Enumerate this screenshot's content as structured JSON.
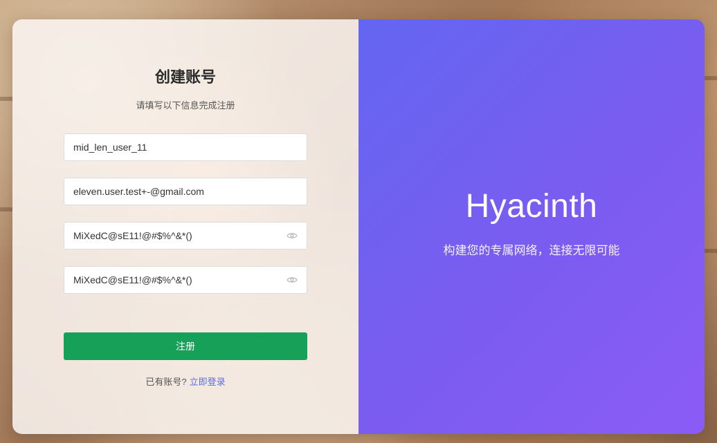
{
  "form": {
    "title": "创建账号",
    "subtitle": "请填写以下信息完成注册",
    "username_value": "mid_len_user_11",
    "email_value": "eleven.user.test+-@gmail.com",
    "password_value": "MiXedC@sE11!@#$%^&*()",
    "confirm_password_value": "MiXedC@sE11!@#$%^&*()",
    "submit_label": "注册",
    "have_account_text": "已有账号?",
    "login_link_label": "立即登录"
  },
  "brand": {
    "name": "Hyacinth",
    "tagline": "构建您的专属网络，连接无限可能"
  },
  "colors": {
    "submit_button": "#17a057",
    "brand_gradient_start": "#6366f1",
    "brand_gradient_end": "#8b5cf6",
    "link": "#5b6ee1"
  },
  "icons": {
    "password_toggle": "eye-icon",
    "confirm_password_toggle": "eye-icon"
  }
}
